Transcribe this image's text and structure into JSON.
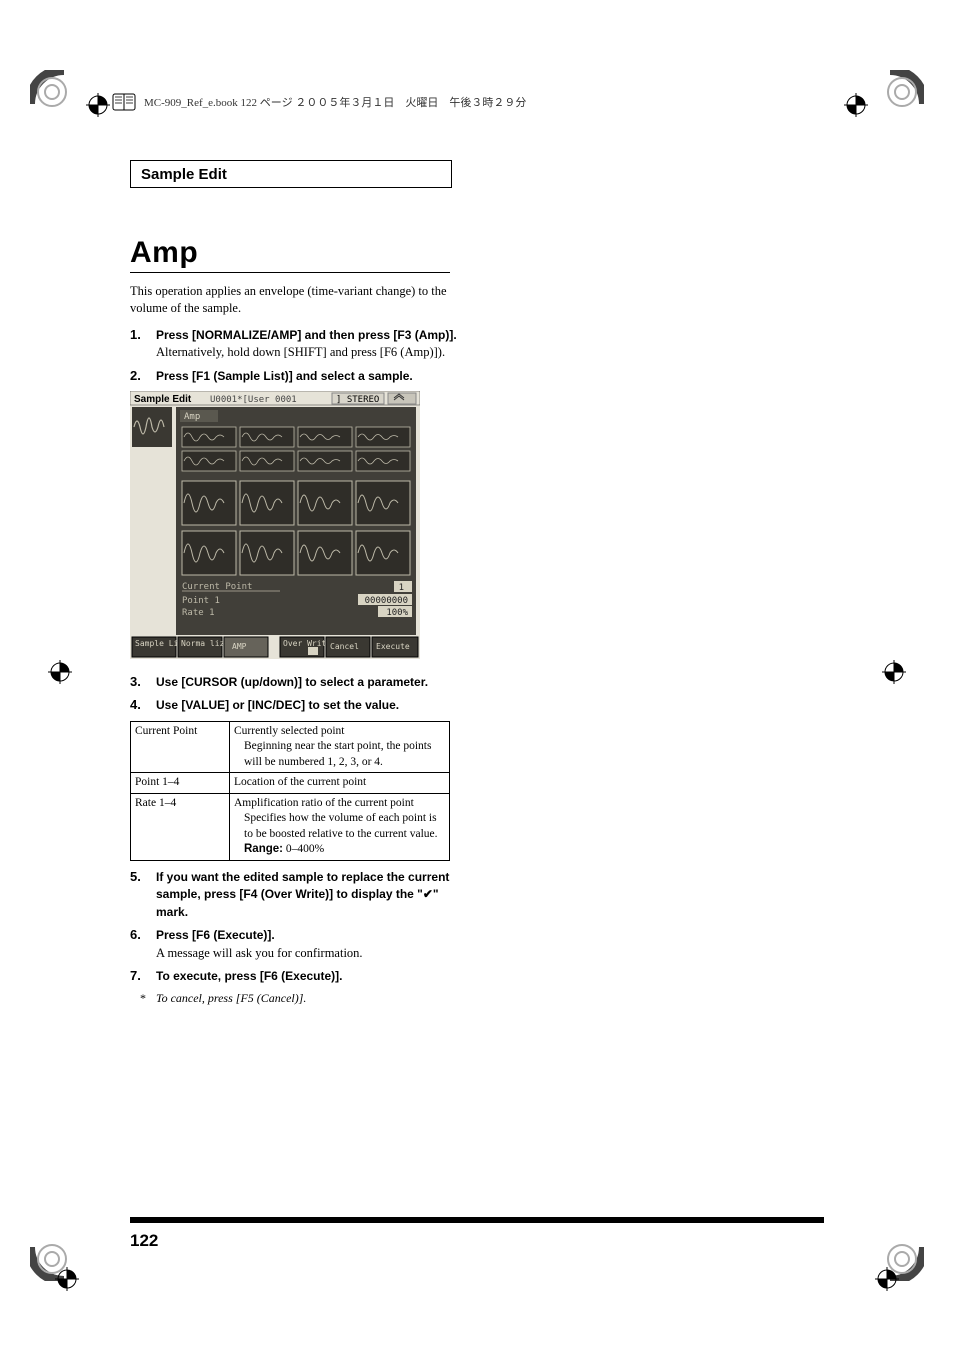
{
  "header": {
    "text": "MC-909_Ref_e.book  122 ページ  ２００５年３月１日　火曜日　午後３時２９分"
  },
  "section_title": "Sample Edit",
  "h1": "Amp",
  "intro": "This operation applies an envelope (time-variant change) to the volume of the sample.",
  "steps": [
    {
      "num": "1.",
      "bold": "Press [NORMALIZE/AMP] and then press [F3 (Amp)].",
      "plain": "Alternatively, hold down [SHIFT] and press [F6 (Amp)])."
    },
    {
      "num": "2.",
      "bold": "Press [F1 (Sample List)] and select a sample."
    },
    {
      "num": "3.",
      "bold": "Use [CURSOR (up/down)] to select a parameter."
    },
    {
      "num": "4.",
      "bold": "Use [VALUE] or [INC/DEC] to set the value."
    },
    {
      "num": "5.",
      "bold": "If you want the edited sample to replace the current sample, press [F4 (Over Write)] to display the \"✔\" mark."
    },
    {
      "num": "6.",
      "bold": "Press [F6 (Execute)].",
      "plain": "A message will ask you for confirmation."
    },
    {
      "num": "7.",
      "bold": "To execute, press [F6 (Execute)]."
    }
  ],
  "footnote": {
    "star": "*",
    "text": "To cancel, press [F5 (Cancel)]."
  },
  "table": [
    {
      "param": "Current Point",
      "desc_main": "Currently selected point",
      "desc_sub": "Beginning near the start point, the points will be numbered 1, 2, 3, or 4."
    },
    {
      "param": "Point 1–4",
      "desc_main": "Location of the current point"
    },
    {
      "param": "Rate 1–4",
      "desc_main": "Amplification ratio of the current point",
      "desc_sub": "Specifies how the volume of each point is to be boosted relative to the current value.",
      "range_label": "Range:",
      "range_value": " 0–400%"
    }
  ],
  "lcd": {
    "title_left": "Sample Edit",
    "title_mid": "U0001*[User 0001",
    "stereo": "] STEREO",
    "panel": "Amp",
    "cp_label": "Current Point",
    "cp_val": "1",
    "p1_label": "Point 1",
    "p1_val": "00000000",
    "r1_label": "Rate 1",
    "r1_val": "100%",
    "f1": "Sample List",
    "f2": "Norma lize",
    "f3": "AMP",
    "f4": "Over Write",
    "f5": "Cancel",
    "f6": "Execute"
  },
  "page_number": "122"
}
